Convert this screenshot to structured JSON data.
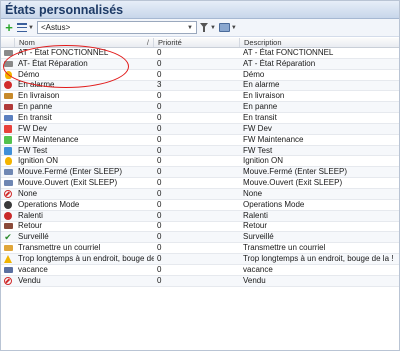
{
  "window": {
    "title": "États personnalisés"
  },
  "toolbar": {
    "select_value": "<Astus>",
    "icons": [
      "plus-icon",
      "list-icon",
      "filter-icon",
      "print-icon"
    ]
  },
  "columns": {
    "name": "Nom",
    "priority": "Priorité",
    "description": "Description",
    "sort_indicator": "/"
  },
  "rows": [
    {
      "icon": "truck-icon",
      "color": "#8a8a8a",
      "name": "AT - État FONCTIONNEL",
      "priority": "0",
      "description": "AT - État FONCTIONNEL"
    },
    {
      "icon": "truck-icon",
      "color": "#8a8a8a",
      "name": "AT- État Réparation",
      "priority": "0",
      "description": "AT - État Réparation"
    },
    {
      "icon": "bulb-icon",
      "color": "#f4b400",
      "name": "Démo",
      "priority": "0",
      "description": "Démo"
    },
    {
      "icon": "alarm-icon",
      "color": "#d12b2b",
      "name": "En alarme",
      "priority": "3",
      "description": "En alarme"
    },
    {
      "icon": "truck-icon",
      "color": "#c78a2b",
      "name": "En livraison",
      "priority": "0",
      "description": "En livraison"
    },
    {
      "icon": "truck-icon",
      "color": "#b03a3a",
      "name": "En panne",
      "priority": "0",
      "description": "En panne"
    },
    {
      "icon": "truck-icon",
      "color": "#5a7fbf",
      "name": "En transit",
      "priority": "0",
      "description": "En transit"
    },
    {
      "icon": "square-icon",
      "color": "#e8413a",
      "name": "FW Dev",
      "priority": "0",
      "description": "FW Dev"
    },
    {
      "icon": "square-icon",
      "color": "#53c24d",
      "name": "FW Maintenance",
      "priority": "0",
      "description": "FW Maintenance"
    },
    {
      "icon": "square-icon",
      "color": "#3f8fd8",
      "name": "FW Test",
      "priority": "0",
      "description": "FW Test"
    },
    {
      "icon": "bulb-icon",
      "color": "#f4b400",
      "name": "Ignition ON",
      "priority": "0",
      "description": "Ignition ON"
    },
    {
      "icon": "tag-icon",
      "color": "#6f87b3",
      "name": "Mouve.Fermé (Enter SLEEP)",
      "priority": "0",
      "description": "Mouve.Fermé (Enter SLEEP)"
    },
    {
      "icon": "tag-icon",
      "color": "#6f87b3",
      "name": "Mouve.Ouvert (Exit SLEEP)",
      "priority": "0",
      "description": "Mouve.Ouvert (Exit SLEEP)"
    },
    {
      "icon": "no-entry-icon",
      "color": "#d12b2b",
      "name": "None",
      "priority": "0",
      "description": "None"
    },
    {
      "icon": "dot-icon",
      "color": "#3a3a3a",
      "name": "Operations Mode",
      "priority": "0",
      "description": "Operations Mode"
    },
    {
      "icon": "slow-icon",
      "color": "#c92a2a",
      "name": "Ralenti",
      "priority": "0",
      "description": "Ralenti"
    },
    {
      "icon": "truck-icon",
      "color": "#8a4a3a",
      "name": "Retour",
      "priority": "0",
      "description": "Retour"
    },
    {
      "icon": "check-icon",
      "color": "#2a8a2a",
      "name": "Surveillé",
      "priority": "0",
      "description": "Surveillé"
    },
    {
      "icon": "mail-icon",
      "color": "#e0a63a",
      "name": "Transmettre un courriel",
      "priority": "0",
      "description": "Transmettre un courriel"
    },
    {
      "icon": "warning-icon",
      "color": "#f0b400",
      "name": "Trop longtemps à un endroit, bouge de...",
      "priority": "0",
      "description": "Trop longtemps à un endroit, bouge de la !"
    },
    {
      "icon": "person-icon",
      "color": "#5a6fa0",
      "name": "vacance",
      "priority": "0",
      "description": "vacance"
    },
    {
      "icon": "no-entry-icon",
      "color": "#d12b2b",
      "name": "Vendu",
      "priority": "0",
      "description": "Vendu"
    }
  ]
}
